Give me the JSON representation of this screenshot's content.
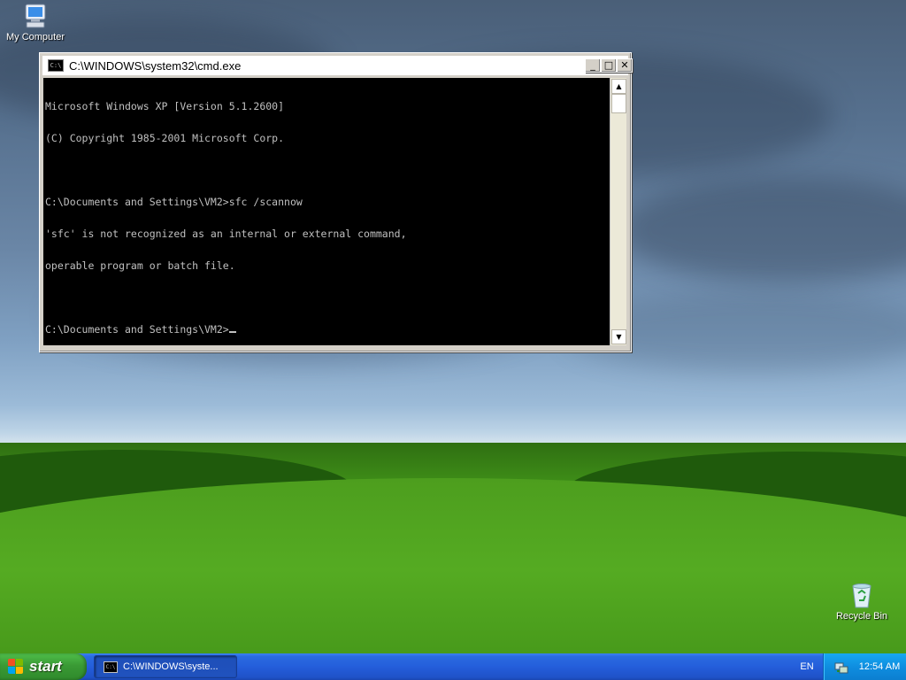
{
  "desktop": {
    "icons": [
      {
        "label": "My Computer",
        "icon": "my-computer-icon"
      },
      {
        "label": "Recycle Bin",
        "icon": "recycle-bin-icon"
      }
    ]
  },
  "cmd_window": {
    "title": "C:\\WINDOWS\\system32\\cmd.exe",
    "title_icon_text": "C:\\",
    "minimize_glyph": "_",
    "maximize_glyph": "□",
    "close_glyph": "✕",
    "console_lines": [
      "Microsoft Windows XP [Version 5.1.2600]",
      "(C) Copyright 1985-2001 Microsoft Corp.",
      "",
      "C:\\Documents and Settings\\VM2>sfc /scannow",
      "'sfc' is not recognized as an internal or external command,",
      "operable program or batch file.",
      "",
      "C:\\Documents and Settings\\VM2>"
    ],
    "scroll_up_glyph": "▲",
    "scroll_down_glyph": "▼"
  },
  "taskbar": {
    "start_label": "start",
    "task_cmd_label": "C:\\WINDOWS\\syste...",
    "task_cmd_icon_text": "C:\\",
    "language": "EN",
    "clock": "12:54 AM"
  },
  "colors": {
    "console_bg": "#000000",
    "console_fg": "#c0c0c0",
    "taskbar_blue": "#245edb",
    "start_green": "#3a9a35",
    "tray_blue": "#0f8ee0"
  }
}
